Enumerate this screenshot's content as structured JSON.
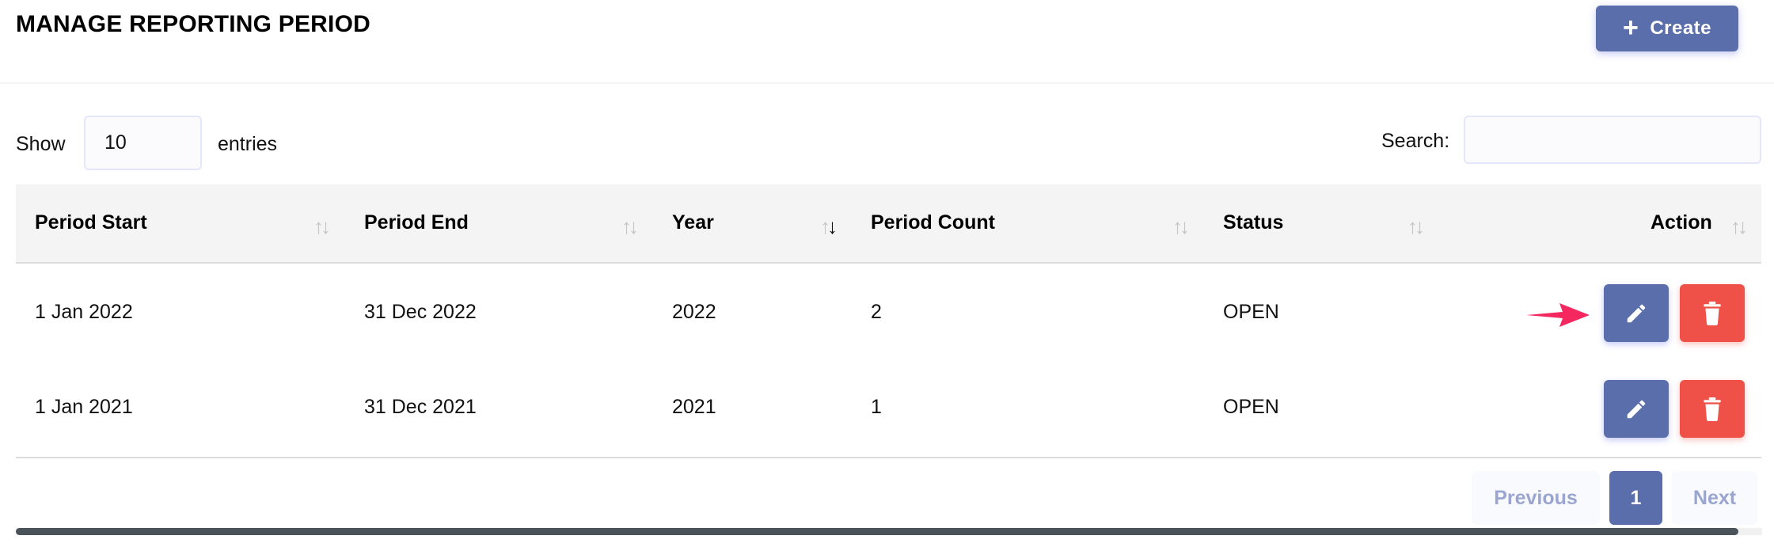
{
  "page": {
    "title": "MANAGE REPORTING PERIOD",
    "create_label": "Create",
    "create_icon": "plus-icon"
  },
  "controls": {
    "show_label": "Show",
    "page_length_value": "10",
    "entries_label": "entries",
    "search_label": "Search:",
    "search_value": ""
  },
  "table": {
    "columns": [
      {
        "label": "Period Start",
        "sort": "none"
      },
      {
        "label": "Period End",
        "sort": "none"
      },
      {
        "label": "Year",
        "sort": "desc"
      },
      {
        "label": "Period Count",
        "sort": "none"
      },
      {
        "label": "Status",
        "sort": "none"
      },
      {
        "label": "Action",
        "sort": "none"
      }
    ],
    "rows": [
      {
        "period_start": "1 Jan 2022",
        "period_end": "31 Dec 2022",
        "year": "2022",
        "period_count": "2",
        "status": "OPEN",
        "actions": [
          "edit",
          "delete"
        ]
      },
      {
        "period_start": "1 Jan 2021",
        "period_end": "31 Dec 2021",
        "year": "2021",
        "period_count": "1",
        "status": "OPEN",
        "actions": [
          "edit",
          "delete"
        ]
      }
    ],
    "sort_icon": {
      "up": "↑",
      "down": "↓"
    }
  },
  "pagination": {
    "previous_label": "Previous",
    "current_page": "1",
    "next_label": "Next"
  },
  "annotation": {
    "pointer": "arrow pointing to edit button of first row",
    "color": "#f4285f"
  },
  "colors": {
    "primary": "#5a6eac",
    "danger": "#ef5047",
    "header_bg": "#f4f4f4"
  }
}
